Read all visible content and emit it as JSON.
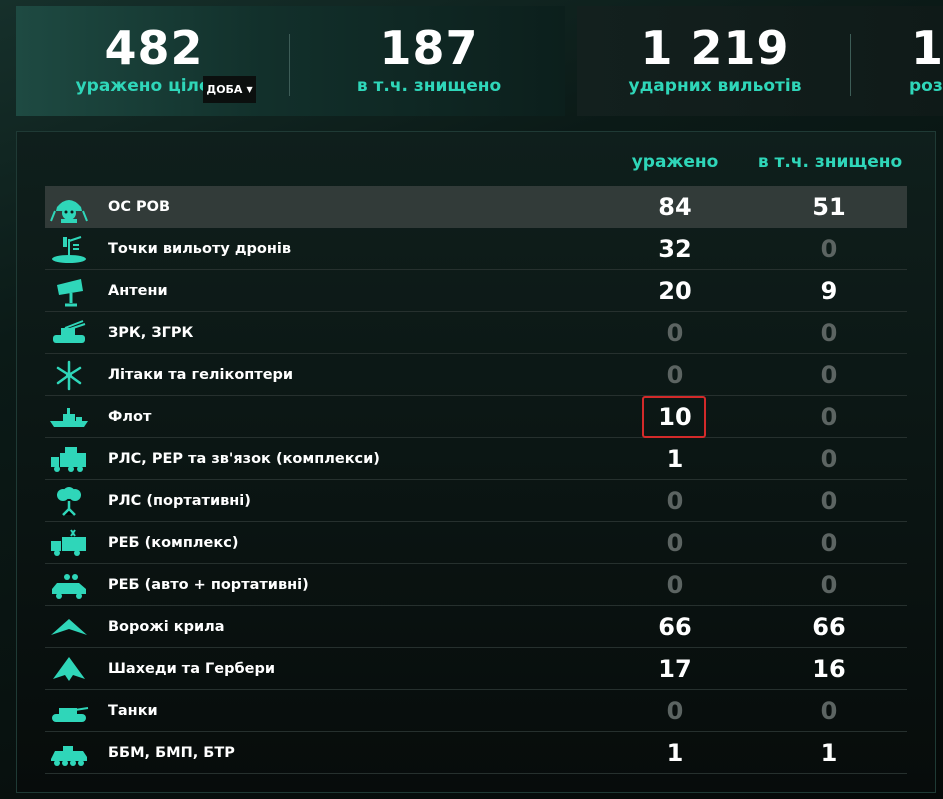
{
  "summary": {
    "targets_hit": {
      "value": "482",
      "label": "уражено цілей"
    },
    "period_select": {
      "value": "ДОБА"
    },
    "destroyed": {
      "value": "187",
      "label": "в т.ч. знищено"
    },
    "strike_sorties": {
      "value": "1 219",
      "label": "ударних вильотів"
    },
    "partial": {
      "value": "1",
      "label": "роз"
    }
  },
  "table": {
    "headers": {
      "hit": "уражено",
      "destroyed": "в т.ч. знищено"
    },
    "rows": [
      {
        "name": "ОС РОВ",
        "hit": "84",
        "destroyed": "51",
        "icon": "soldier-helmet-icon"
      },
      {
        "name": "Точки вильоту дронів",
        "hit": "32",
        "destroyed": "0",
        "icon": "launch-point-icon"
      },
      {
        "name": "Антени",
        "hit": "20",
        "destroyed": "9",
        "icon": "antenna-icon"
      },
      {
        "name": "ЗРК, ЗГРК",
        "hit": "0",
        "destroyed": "0",
        "icon": "air-defense-vehicle-icon"
      },
      {
        "name": "Літаки та гелікоптери",
        "hit": "0",
        "destroyed": "0",
        "icon": "rotor-icon"
      },
      {
        "name": "Флот",
        "hit": "10",
        "destroyed": "0",
        "icon": "ship-icon"
      },
      {
        "name": "РЛС, РЕР та зв'язок (комплекси)",
        "hit": "1",
        "destroyed": "0",
        "icon": "radar-truck-icon"
      },
      {
        "name": "РЛС (портативні)",
        "hit": "0",
        "destroyed": "0",
        "icon": "portable-radar-icon"
      },
      {
        "name": "РЕБ (комплекс)",
        "hit": "0",
        "destroyed": "0",
        "icon": "ew-truck-icon"
      },
      {
        "name": "РЕБ (авто + портативні)",
        "hit": "0",
        "destroyed": "0",
        "icon": "ew-car-icon"
      },
      {
        "name": "Ворожі крила",
        "hit": "66",
        "destroyed": "66",
        "icon": "wing-drone-icon"
      },
      {
        "name": "Шахеди та Гербери",
        "hit": "17",
        "destroyed": "16",
        "icon": "shahed-drone-icon"
      },
      {
        "name": "Танки",
        "hit": "0",
        "destroyed": "0",
        "icon": "tank-icon"
      },
      {
        "name": "ББМ, БМП, БТР",
        "hit": "1",
        "destroyed": "1",
        "icon": "apc-icon"
      }
    ]
  },
  "colors": {
    "accent": "#2fd6b9",
    "zero_value": "#5c6462",
    "highlight_row": "#323b39",
    "selection_box": "#d32a2a"
  }
}
